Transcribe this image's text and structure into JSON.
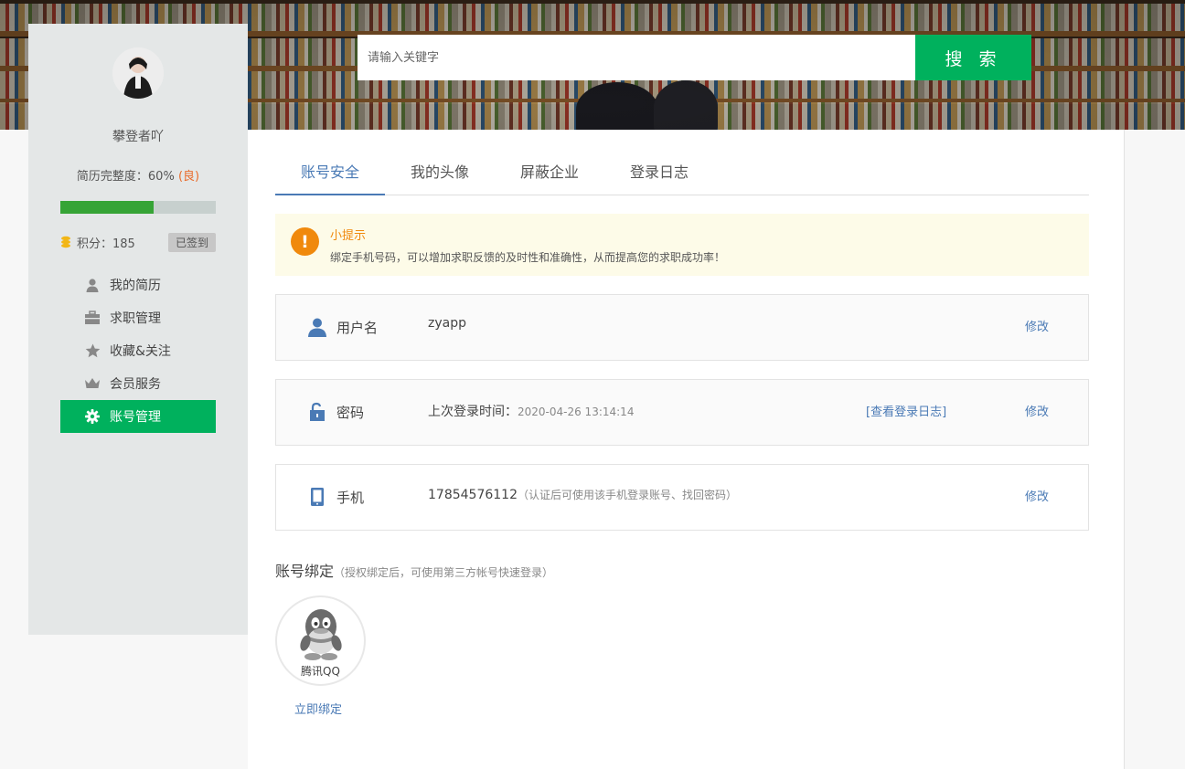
{
  "search": {
    "placeholder": "请输入关键字",
    "button_label": "搜 索"
  },
  "profile": {
    "username": "攀登者吖",
    "completeness_label": "简历完整度：60% ",
    "completeness_grade": "(良)",
    "completeness_fraction": 0.6,
    "points_label": "积分：185",
    "signed_label": "已签到"
  },
  "sidebar": {
    "items": [
      {
        "label": "我的简历",
        "icon": "user-icon"
      },
      {
        "label": "求职管理",
        "icon": "briefcase-icon"
      },
      {
        "label": "收藏&关注",
        "icon": "star-icon"
      },
      {
        "label": "会员服务",
        "icon": "crown-icon"
      },
      {
        "label": "账号管理",
        "icon": "gear-icon",
        "active": true
      }
    ]
  },
  "tabs": [
    {
      "label": "账号安全",
      "active": true
    },
    {
      "label": "我的头像"
    },
    {
      "label": "屏蔽企业"
    },
    {
      "label": "登录日志"
    }
  ],
  "tip": {
    "title": "小提示",
    "text": "绑定手机号码，可以增加求职反馈的及时性和准确性，从而提高您的求职成功率！"
  },
  "account": {
    "username_row": {
      "label": "用户名",
      "value": "zyapp",
      "action": "修改"
    },
    "password_row": {
      "label": "密码",
      "value_prefix": "上次登录时间：",
      "value_time": "2020-04-26 13:14:14",
      "log_link": "[查看登录日志]",
      "action": "修改"
    },
    "phone_row": {
      "label": "手机",
      "value": "17854576112",
      "note": "（认证后可使用该手机登录账号、找回密码）",
      "action": "修改"
    }
  },
  "binding": {
    "title": "账号绑定",
    "subtitle": "（授权绑定后，可使用第三方帐号快速登录）",
    "qq_label": "腾讯QQ",
    "bind_link": "立即绑定"
  },
  "colors": {
    "accent_green": "#00b15d",
    "link_blue": "#4a7ab5",
    "tip_orange": "#f0890c",
    "grade_orange": "#e96b2a"
  }
}
